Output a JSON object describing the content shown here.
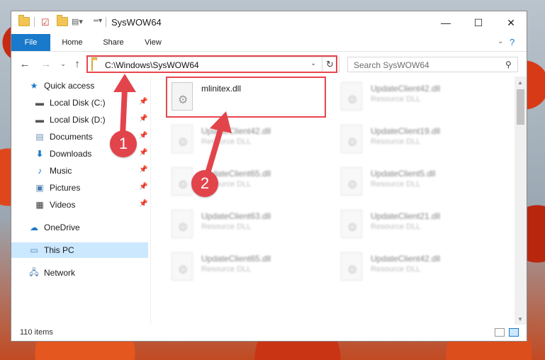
{
  "window": {
    "title": "SysWOW64"
  },
  "ribbon": {
    "tabs": [
      "File",
      "Home",
      "Share",
      "View"
    ]
  },
  "address": {
    "path": "C:\\Windows\\SysWOW64",
    "search_placeholder": "Search SysWOW64"
  },
  "nav": {
    "quick_access": "Quick access",
    "items": [
      "Local Disk (C:)",
      "Local Disk (D:)",
      "Documents",
      "Downloads",
      "Music",
      "Pictures",
      "Videos"
    ],
    "onedrive": "OneDrive",
    "thispc": "This PC",
    "network": "Network"
  },
  "files": [
    {
      "name": "mlinitex.dll",
      "type": ""
    },
    {
      "name": "UpdateClient42.dll",
      "type": "Resource DLL"
    },
    {
      "name": "UpdateClient42.dll",
      "type": "Resource DLL"
    },
    {
      "name": "UpdateClient19.dll",
      "type": "Resource DLL"
    },
    {
      "name": "UpdateClient65.dll",
      "type": "Resource DLL"
    },
    {
      "name": "UpdateClient5.dll",
      "type": "Resource DLL"
    },
    {
      "name": "UpdateClient63.dll",
      "type": "Resource DLL"
    },
    {
      "name": "UpdateClient21.dll",
      "type": "Resource DLL"
    },
    {
      "name": "UpdateClient65.dll",
      "type": "Resource DLL"
    },
    {
      "name": "UpdateClient42.dll",
      "type": "Resource DLL"
    }
  ],
  "status": {
    "count": "110 items"
  },
  "annotations": {
    "step1": "1",
    "step2": "2"
  },
  "colors": {
    "accent": "#1979ca",
    "highlight": "#e8464d",
    "selection": "#cce8ff"
  }
}
